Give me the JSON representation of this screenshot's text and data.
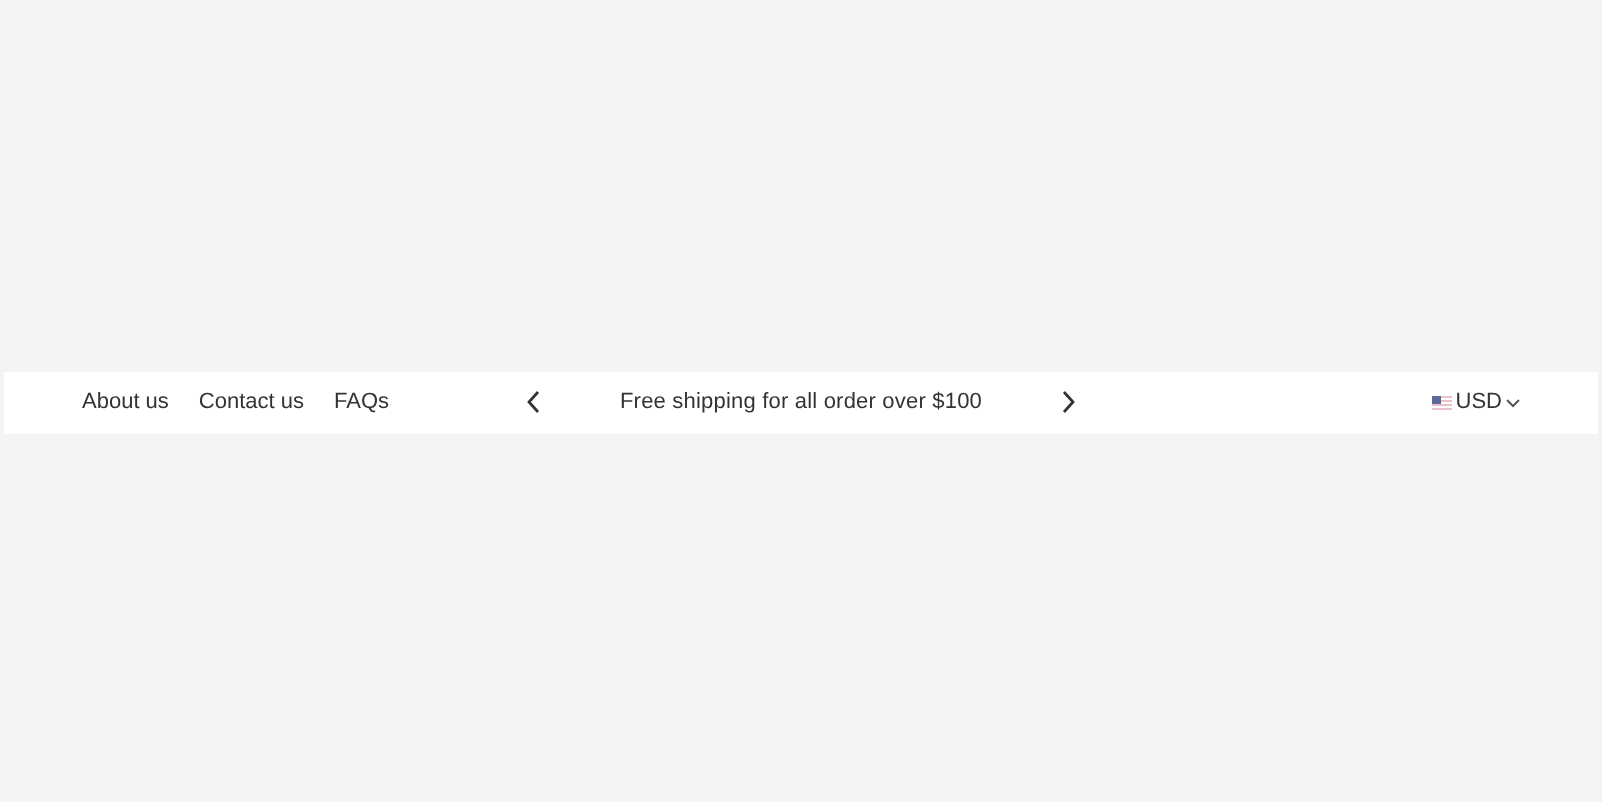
{
  "links": [
    "About us",
    "Contact us",
    "FAQs"
  ],
  "announcement": {
    "text": "Free shipping for all order over $100"
  },
  "currency": {
    "label": "USD"
  }
}
